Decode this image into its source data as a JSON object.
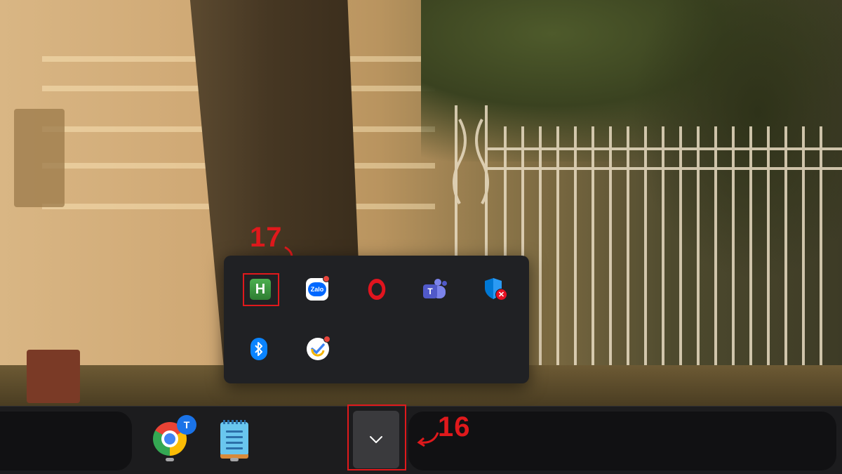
{
  "annotations": {
    "flyout_marker": "17",
    "button_marker": "16",
    "color": "#e0191c"
  },
  "tray_flyout": {
    "icons": [
      {
        "name": "hwk-icon",
        "glyph": "H",
        "color": "#2e7d32"
      },
      {
        "name": "zalo-icon",
        "glyph": "Zalo",
        "color": "#0068ff",
        "notification_dot": true
      },
      {
        "name": "opera-icon",
        "color": "#e0141e"
      },
      {
        "name": "microsoft-teams-icon",
        "glyph": "T",
        "color": "#5059c9"
      },
      {
        "name": "windows-security-icon",
        "status": "warning",
        "color": "#0078d4"
      },
      {
        "name": "bluetooth-icon",
        "color": "#0a84ff"
      },
      {
        "name": "ticktick-icon",
        "notification_dot": true
      }
    ]
  },
  "taskbar": {
    "apps": [
      {
        "name": "chrome-icon",
        "badge": "T",
        "running": true
      },
      {
        "name": "notepad-icon",
        "running": true
      }
    ],
    "overflow_button": {
      "icon": "chevron-up-icon"
    }
  }
}
